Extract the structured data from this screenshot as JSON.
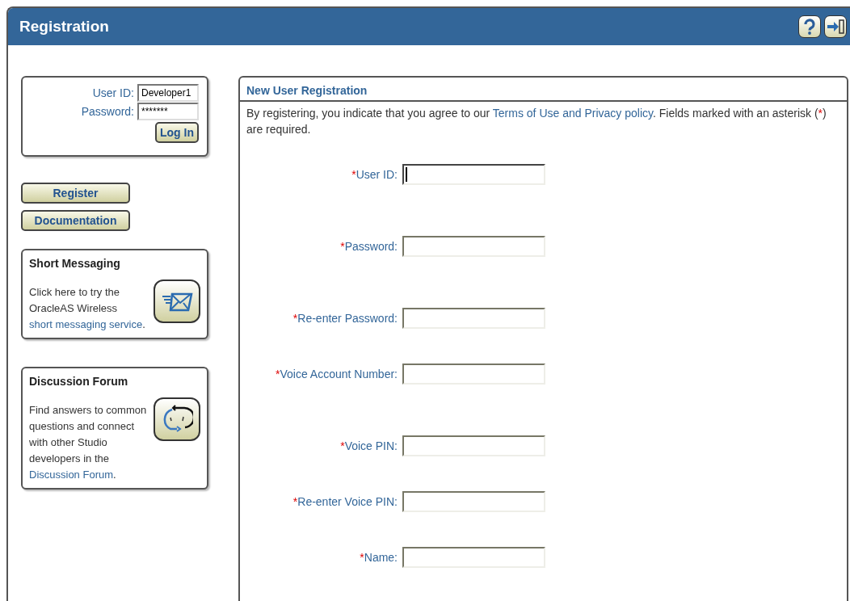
{
  "window": {
    "title": "Registration"
  },
  "login": {
    "fields": [
      {
        "label": "User ID:",
        "value": "Developer1"
      },
      {
        "label": "Password:",
        "value": "*******"
      }
    ],
    "button": "Log In"
  },
  "nav_buttons": [
    "Register",
    "Documentation"
  ],
  "panels": [
    {
      "kind": "messaging",
      "title": "Short Messaging",
      "text": "Click here to try the OracleAS Wireless ",
      "link": "short messaging service",
      "after": "."
    },
    {
      "kind": "forum",
      "title": "Discussion Forum",
      "text": "Find answers to common questions and connect with other Studio developers in the ",
      "link": "Discussion Forum",
      "after": "."
    }
  ],
  "registration": {
    "title": "New User Registration",
    "intro": {
      "before": "By registering, you indicate that you agree to our ",
      "link": "Terms of Use and Privacy policy",
      "middle": ". Fields marked with an asterisk (",
      "mark": "*",
      "after": ") are required."
    },
    "fields": [
      {
        "mark": "*",
        "label": "User ID:",
        "focused": true
      },
      {
        "mark": "*",
        "label": "Password:",
        "focused": false
      },
      {
        "mark": "*",
        "label": "Re-enter Password:",
        "focused": false
      },
      {
        "mark": "*",
        "label": "Voice Account Number:",
        "focused": false
      },
      {
        "mark": "*",
        "label": "Voice PIN:",
        "focused": false
      },
      {
        "mark": "*",
        "label": "Re-enter Voice PIN:",
        "focused": false
      },
      {
        "mark": "*",
        "label": "Name:",
        "focused": false
      }
    ]
  }
}
